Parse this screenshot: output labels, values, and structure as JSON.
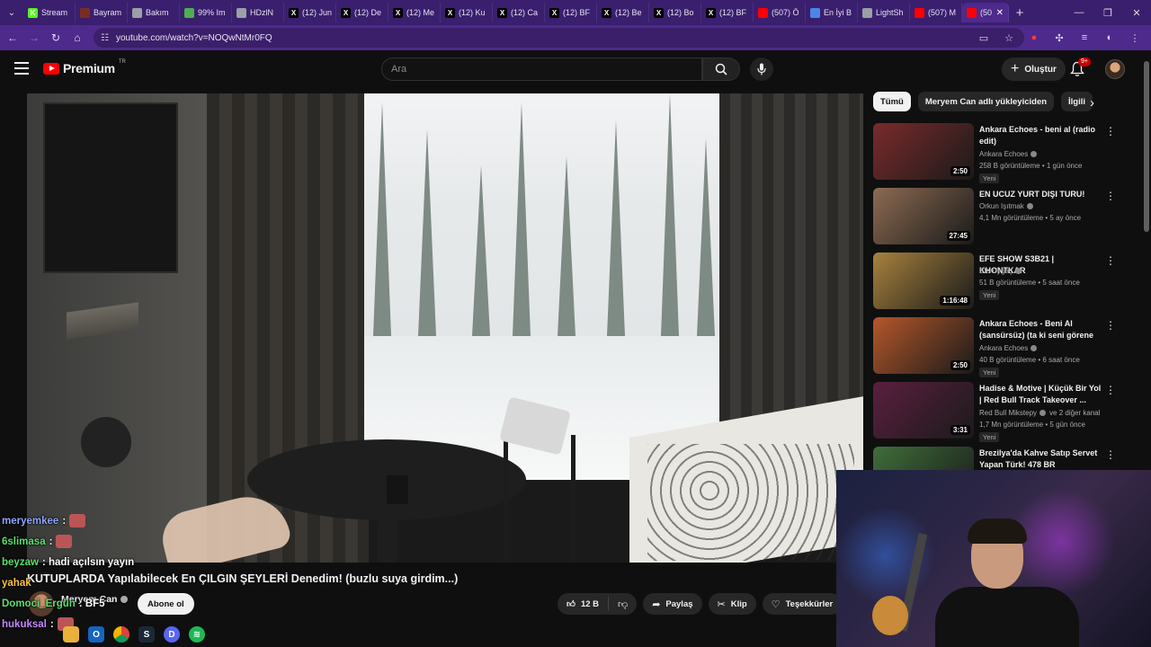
{
  "browser": {
    "tabs": [
      {
        "label": "Stream",
        "favicon_color": "#53fc18",
        "favicon_letter": "K"
      },
      {
        "label": "Bayram",
        "favicon_color": "#7a2d1f",
        "favicon_letter": ""
      },
      {
        "label": "Bakım",
        "favicon_color": "#9aa0a6",
        "favicon_letter": ""
      },
      {
        "label": "99% Im",
        "favicon_color": "#4caf50",
        "favicon_letter": ""
      },
      {
        "label": "HDzlN",
        "favicon_color": "#9aa0a6",
        "favicon_letter": ""
      },
      {
        "label": "(12) Jun",
        "favicon_color": "#000000",
        "favicon_letter": "X"
      },
      {
        "label": "(12) De",
        "favicon_color": "#000000",
        "favicon_letter": "X"
      },
      {
        "label": "(12) Me",
        "favicon_color": "#000000",
        "favicon_letter": "X"
      },
      {
        "label": "(12) Ku",
        "favicon_color": "#000000",
        "favicon_letter": "X"
      },
      {
        "label": "(12) Ca",
        "favicon_color": "#000000",
        "favicon_letter": "X"
      },
      {
        "label": "(12) BF",
        "favicon_color": "#000000",
        "favicon_letter": "X"
      },
      {
        "label": "(12) Be",
        "favicon_color": "#000000",
        "favicon_letter": "X"
      },
      {
        "label": "(12) Bo",
        "favicon_color": "#000000",
        "favicon_letter": "X"
      },
      {
        "label": "(12) BF",
        "favicon_color": "#000000",
        "favicon_letter": "X"
      },
      {
        "label": "(507) Ö",
        "favicon_color": "#ff0000",
        "favicon_letter": ""
      },
      {
        "label": "En İyi B",
        "favicon_color": "#4a86e8",
        "favicon_letter": ""
      },
      {
        "label": "LightSh",
        "favicon_color": "#9aa0a6",
        "favicon_letter": ""
      },
      {
        "label": "(507) M",
        "favicon_color": "#ff0000",
        "favicon_letter": ""
      }
    ],
    "active_tab": {
      "label": "(50",
      "favicon_color": "#ff0000"
    },
    "new_tab": "+",
    "url": "youtube.com/watch?v=NOQwNtMr0FQ"
  },
  "header": {
    "logo_text": "Premium",
    "logo_region": "TR",
    "search_placeholder": "Ara",
    "create_label": "Oluştur",
    "notification_count": "9+"
  },
  "video": {
    "title": "KUTUPLARDA Yapılabilecek En ÇILGIN ŞEYLERİ Denedim! (buzlu suya girdim...)",
    "channel": "Meryem Can",
    "subscribe_label": "Abone ol",
    "likes": "12 B",
    "share_label": "Paylaş",
    "clip_label": "Klip",
    "thanks_label": "Teşekkürler"
  },
  "chips": [
    "Tümü",
    "Meryem Can adlı yükleyiciden",
    "İlgili"
  ],
  "recommendations": [
    {
      "title": "Ankara Echoes - beni al (radio edit)",
      "channel": "Ankara Echoes",
      "meta": "258 B görüntüleme • 1 gün önce",
      "badge": "Yeni",
      "duration": "2:50",
      "thumb_color": "#7a2a2a"
    },
    {
      "title": "EN UCUZ YURT DIŞI TURU!",
      "channel": "Orkun Işıtmak",
      "meta": "4,1 Mn görüntüleme • 5 ay önce",
      "badge": "",
      "duration": "27:45",
      "thumb_color": "#8d6b52"
    },
    {
      "title": "EFE SHOW S3B21 | KHONTKAR",
      "channel": "Efe Uygaç",
      "meta": "51 B görüntüleme • 5 saat önce",
      "badge": "Yeni",
      "duration": "1:16:48",
      "thumb_color": "#a8823e"
    },
    {
      "title": "Ankara Echoes - Beni Al (sansürsüz) (ta ki seni görene ...",
      "channel": "Ankara Echoes",
      "meta": "40 B görüntüleme • 6 saat önce",
      "badge": "Yeni",
      "duration": "2:50",
      "thumb_color": "#b5572a"
    },
    {
      "title": "Hadise & Motive | Küçük Bir Yol | Red Bull Track Takeover ...",
      "channel": "Red Bull Mikstepy",
      "meta": "1,7 Mn görüntüleme • 5 gün önce",
      "badge": "Yeni",
      "duration": "3:31",
      "thumb_color": "#5b1f3f",
      "channel_extra": "ve 2 diğer kanal"
    },
    {
      "title": "Brezilya'da Kahve Satıp Servet Yapan Türk! 478 BR",
      "channel": "",
      "meta": "",
      "badge": "",
      "duration": "",
      "thumb_color": "#3f6e3a"
    }
  ],
  "chat": [
    {
      "user": "meryemkee",
      "color": "#8fa7ff",
      "text": ":"
    },
    {
      "user": "6slimasa",
      "color": "#59e06c",
      "text": ":"
    },
    {
      "user": "beyzaw",
      "color": "#59e06c",
      "text": ": hadi açılsın yayın"
    },
    {
      "user": "yahak",
      "color": "#f5c142",
      "text": ""
    },
    {
      "user": "Domoci_Ergün",
      "color": "#59e06c",
      "text": ": BF5"
    },
    {
      "user": "hukuksal",
      "color": "#c489ff",
      "text": ":"
    }
  ]
}
